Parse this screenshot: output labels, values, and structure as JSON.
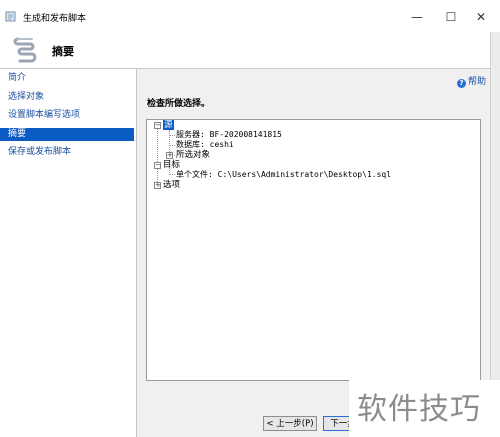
{
  "window": {
    "title": "生成和发布脚本",
    "minimize_glyph": "—",
    "maximize_glyph": "☐",
    "close_glyph": "✕"
  },
  "header": {
    "title": "摘要",
    "icon": "script-scroll-icon"
  },
  "sidebar": {
    "items": [
      {
        "label": "简介",
        "selected": false
      },
      {
        "label": "选择对象",
        "selected": false
      },
      {
        "label": "设置脚本编写选项",
        "selected": false
      },
      {
        "label": "摘要",
        "selected": true
      },
      {
        "label": "保存或发布脚本",
        "selected": false
      }
    ]
  },
  "main": {
    "help_label": "帮助",
    "help_icon": "help-icon",
    "section_title": "检查所做选择。",
    "tree": {
      "source": "源",
      "server": "服务器: BF-202008141815",
      "database": "数据库: ceshi",
      "selected_objects": "所选对象",
      "target": "目标",
      "single_file": "单个文件: C:\\Users\\Administrator\\Desktop\\1.sql",
      "options": "选项"
    }
  },
  "buttons": {
    "prev": "< 上一步(P)",
    "next": "下一步"
  },
  "watermark": {
    "text": "软件技巧"
  },
  "colors": {
    "selection": "#0a5bc4",
    "link": "#1a4fa0"
  }
}
